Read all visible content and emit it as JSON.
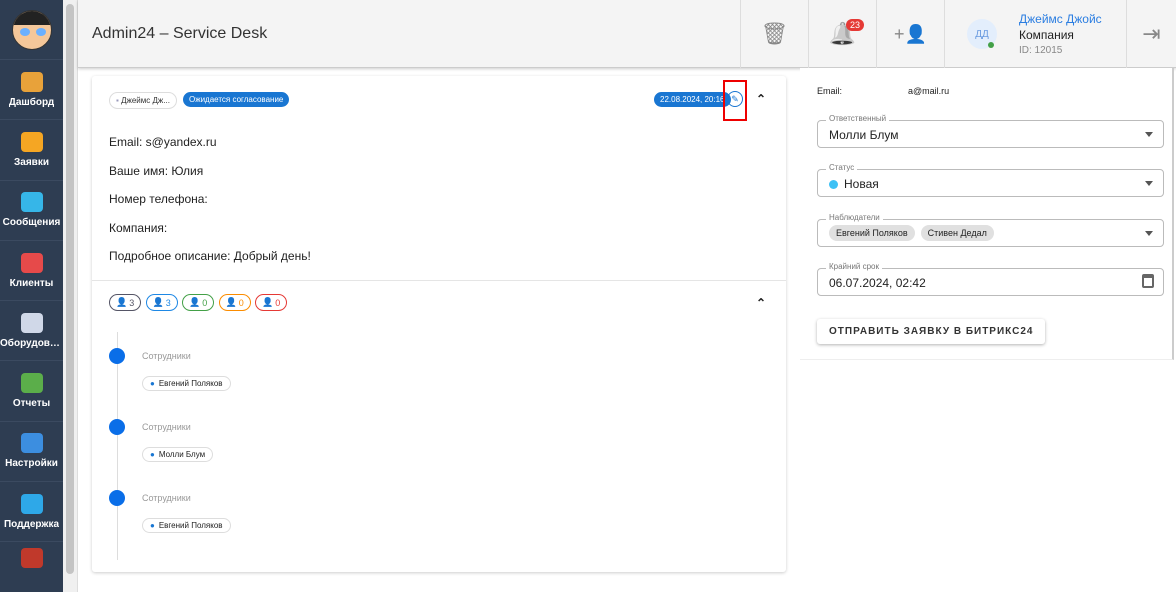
{
  "sidebar": {
    "items": [
      {
        "label": "Дашборд",
        "color": "#e8a23a"
      },
      {
        "label": "Заявки",
        "color": "#f5a623"
      },
      {
        "label": "Сообщения",
        "color": "#36b6e8"
      },
      {
        "label": "Клиенты",
        "color": "#e64a4a"
      },
      {
        "label": "Оборудован...",
        "color": "#d0d8e8"
      },
      {
        "label": "Отчеты",
        "color": "#5bae4a"
      },
      {
        "label": "Настройки",
        "color": "#3c8ee0"
      },
      {
        "label": "Поддержка",
        "color": "#2ea8e8"
      }
    ]
  },
  "header": {
    "title": "Admin24 – Service Desk",
    "notifications": "23",
    "user": {
      "initials": "ДД",
      "name": "Джеймс Джойс",
      "company": "Компания",
      "id": "ID: 12015"
    }
  },
  "ticket": {
    "author": "Джеймс Дж...",
    "status": "Ожидается согласование",
    "date": "22.08.2024, 20:16",
    "lines": [
      "Email: s@yandex.ru",
      "Ваше имя: Юлия",
      "Номер телефона:",
      "Компания:",
      "Подробное описание: Добрый день!"
    ],
    "counters": [
      {
        "value": "3",
        "color": "#556"
      },
      {
        "value": "3",
        "color": "#1e88e5"
      },
      {
        "value": "0",
        "color": "#43a047"
      },
      {
        "value": "0",
        "color": "#fb8c00"
      },
      {
        "value": "0",
        "color": "#e53935"
      }
    ],
    "timeline": [
      {
        "label": "Сотрудники",
        "person": "Евгений Поляков"
      },
      {
        "label": "Сотрудники",
        "person": "Молли Блум"
      },
      {
        "label": "Сотрудники",
        "person": "Евгений Поляков"
      }
    ]
  },
  "panel": {
    "email_label": "Email:",
    "email": "a@mail.ru",
    "responsible_label": "Ответственный",
    "responsible": "Молли Блум",
    "status_label": "Статус",
    "status": "Новая",
    "status_color": "#3ec1f5",
    "watchers_label": "Наблюдатели",
    "watchers": [
      "Евгений Поляков",
      "Стивен Дедал"
    ],
    "deadline_label": "Крайний срок",
    "deadline": "06.07.2024, 02:42",
    "send_button": "ОТПРАВИТЬ ЗАЯВКУ В БИТРИКС24"
  }
}
